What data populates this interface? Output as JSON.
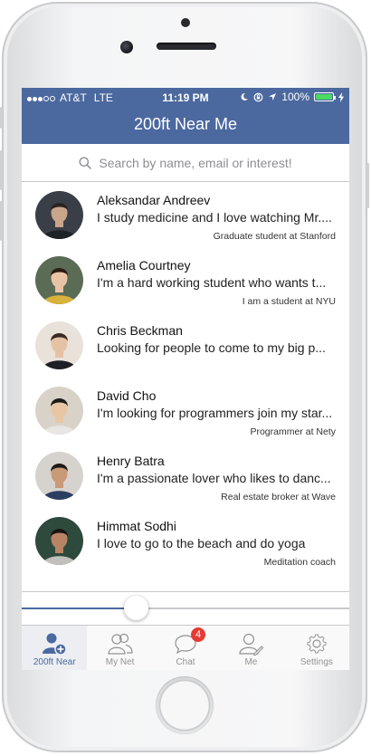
{
  "status_bar": {
    "carrier": "AT&T",
    "network": "LTE",
    "time": "11:19 PM",
    "battery": "100%",
    "battery_level": 1.0,
    "icons": [
      "signal-dots-icon",
      "moon-icon",
      "rotation-lock-icon",
      "location-arrow-icon",
      "battery-icon",
      "charging-bolt-icon"
    ]
  },
  "nav": {
    "title": "200ft Near Me"
  },
  "search": {
    "placeholder": "Search by name, email or interest!"
  },
  "people": [
    {
      "name": "Aleksandar Andreev",
      "message": "I study medicine and I love watching Mr....",
      "role": "Graduate student at Stanford"
    },
    {
      "name": "Amelia Courtney",
      "message": "I'm a hard working student who wants t...",
      "role": "I am a student at NYU"
    },
    {
      "name": "Chris Beckman",
      "message": "Looking for people to come to my big p...",
      "role": ""
    },
    {
      "name": "David Cho",
      "message": "I'm looking for programmers join my star...",
      "role": "Programmer at Nety"
    },
    {
      "name": "Henry Batra",
      "message": "I'm a passionate lover who likes to danc...",
      "role": "Real estate broker at Wave"
    },
    {
      "name": "Himmat Sodhi",
      "message": "I love to go to the beach and do yoga",
      "role": "Meditation coach"
    }
  ],
  "distance_slider": {
    "fraction": 0.35
  },
  "tabs": [
    {
      "label": "200ft Near",
      "icon": "person-add-icon",
      "active": true
    },
    {
      "label": "My Net",
      "icon": "people-icon",
      "active": false
    },
    {
      "label": "Chat",
      "icon": "chat-bubble-icon",
      "active": false,
      "badge": "4"
    },
    {
      "label": "Me",
      "icon": "person-edit-icon",
      "active": false
    },
    {
      "label": "Settings",
      "icon": "gear-icon",
      "active": false
    }
  ],
  "colors": {
    "brand": "#4b699f",
    "badge": "#e53b35",
    "battery_fill": "#4cd964"
  }
}
